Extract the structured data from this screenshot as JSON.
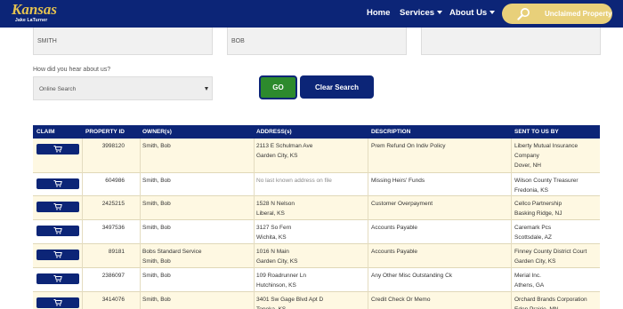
{
  "header": {
    "logo_text": "Kansas",
    "logo_subtext": "Jake LaTurner",
    "nav": [
      {
        "label": "Home"
      },
      {
        "label": "Services"
      },
      {
        "label": "About Us"
      }
    ],
    "unclaimed_label": "Unclaimed Property"
  },
  "search": {
    "last_name": "SMITH",
    "first_name": "BOB",
    "third_field": "",
    "hear_label": "How did you hear about us?",
    "hear_value": "Online Search",
    "go_label": "GO",
    "clear_label": "Clear Search"
  },
  "table": {
    "headers": [
      "CLAIM",
      "PROPERTY ID",
      "OWNER(s)",
      "ADDRESS(s)",
      "DESCRIPTION",
      "SENT TO US BY"
    ],
    "rows": [
      {
        "id": "3998120",
        "owner": [
          "Smith, Bob"
        ],
        "address": [
          "2113 E Schulman Ave",
          "Garden City, KS"
        ],
        "description": "Prem Refund On Indiv Policy",
        "sent": [
          "Liberty Mutual Insurance",
          "Company",
          "Dover, NH"
        ]
      },
      {
        "id": "604986",
        "owner": [
          "Smith, Bob"
        ],
        "address": [
          "No last known address on file"
        ],
        "description": "Missing Heirs' Funds",
        "sent": [
          "Wilson County Treasurer",
          "Fredonia, KS"
        ]
      },
      {
        "id": "2425215",
        "owner": [
          "Smith, Bob"
        ],
        "address": [
          "1528 N Nelson",
          "Liberal, KS"
        ],
        "description": "Customer Overpayment",
        "sent": [
          "Cellco Partnership",
          "Basking Ridge, NJ"
        ]
      },
      {
        "id": "3497536",
        "owner": [
          "Smith, Bob"
        ],
        "address": [
          "3127 So Fern",
          "Wichita, KS"
        ],
        "description": "Accounts Payable",
        "sent": [
          "Caremark Pcs",
          "Scottsdale, AZ"
        ]
      },
      {
        "id": "89181",
        "owner": [
          "Bobs Standard Service",
          "Smith, Bob"
        ],
        "address": [
          "1016 N Main",
          "Garden City, KS"
        ],
        "description": "Accounts Payable",
        "sent": [
          "Finney County District Court",
          "Garden City, KS"
        ]
      },
      {
        "id": "2386097",
        "owner": [
          "Smith, Bob"
        ],
        "address": [
          "109 Roadrunner Ln",
          "Hutchinson, KS"
        ],
        "description": "Any Other Misc Outstanding Ck",
        "sent": [
          "Merial Inc.",
          "Athens, GA"
        ]
      },
      {
        "id": "3414076",
        "owner": [
          "Smith, Bob"
        ],
        "address": [
          "3401 Sw Gage Blvd Apt D",
          "Topeka, KS"
        ],
        "description": "Credit Check Or Memo",
        "sent": [
          "Orchard Brands Corporation",
          "Eden Prairie, MN"
        ]
      }
    ]
  },
  "colors": {
    "navy": "#0c2577",
    "gold": "#e8d07a",
    "green": "#2d8a2d",
    "row_highlight": "#fef8e2"
  },
  "icons": {
    "claim": "cart-icon",
    "unclaimed": "magnifier-icon",
    "dropdown": "caret-down-icon"
  }
}
